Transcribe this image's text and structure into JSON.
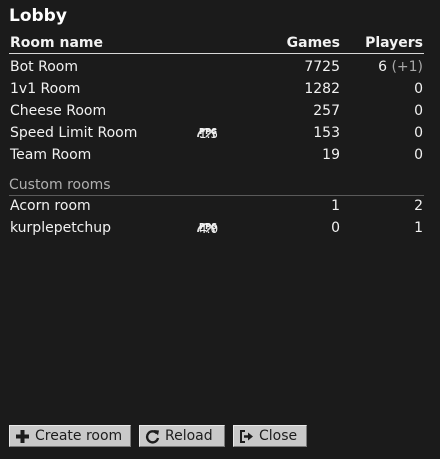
{
  "title": "Lobby",
  "columns": {
    "name": "Room name",
    "games": "Games",
    "players": "Players"
  },
  "rooms": [
    {
      "name": "Bot Room",
      "speed": "",
      "speed_unit": "",
      "games": "7725",
      "players": "6",
      "players_extra": "(+1)"
    },
    {
      "name": "1v1 Room",
      "speed": "",
      "speed_unit": "",
      "games": "1282",
      "players": "0",
      "players_extra": ""
    },
    {
      "name": "Cheese Room",
      "speed": "",
      "speed_unit": "",
      "games": "257",
      "players": "0",
      "players_extra": ""
    },
    {
      "name": "Speed Limit Room",
      "speed": "1.5",
      "speed_unit": "PPS",
      "games": "153",
      "players": "0",
      "players_extra": ""
    },
    {
      "name": "Team Room",
      "speed": "",
      "speed_unit": "",
      "games": "19",
      "players": "0",
      "players_extra": ""
    }
  ],
  "custom_rooms_label": "Custom rooms",
  "custom_rooms": [
    {
      "name": "Acorn room",
      "speed": "",
      "speed_unit": "",
      "games": "1",
      "players": "2",
      "players_extra": ""
    },
    {
      "name": "kurplepetchup",
      "speed": "4.0",
      "speed_unit": "PPS",
      "games": "0",
      "players": "1",
      "players_extra": ""
    }
  ],
  "buttons": {
    "create": {
      "label": "Create room",
      "icon": "plus-icon"
    },
    "reload": {
      "label": "Reload",
      "icon": "reload-icon"
    },
    "close": {
      "label": "Close",
      "icon": "exit-icon"
    }
  },
  "colors": {
    "background": "#1b1b1b",
    "text": "#f2f2f2",
    "muted": "#a8a8a8",
    "button": "#c9c9c9"
  }
}
